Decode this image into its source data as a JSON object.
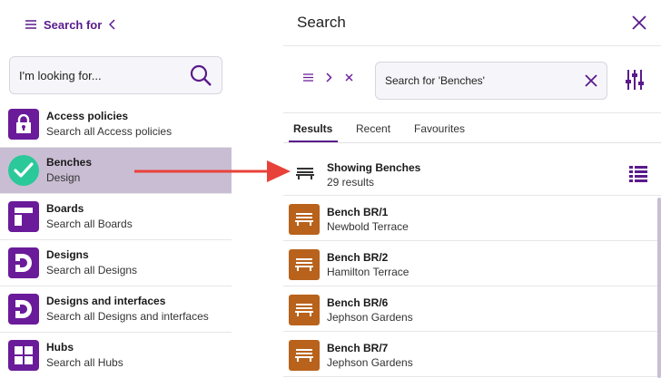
{
  "left_panel": {
    "header_title": "Search for",
    "search_placeholder": "I'm looking for...",
    "items": [
      {
        "title": "Access policies",
        "subtitle": "Search all Access policies",
        "icon": "lock-icon"
      },
      {
        "title": "Benches",
        "subtitle": "Design",
        "icon": "check-icon",
        "selected": true
      },
      {
        "title": "Boards",
        "subtitle": "Search all Boards",
        "icon": "board-icon"
      },
      {
        "title": "Designs",
        "subtitle": "Search all Designs",
        "icon": "design-icon"
      },
      {
        "title": "Designs and interfaces",
        "subtitle": "Search all Designs and interfaces",
        "icon": "design-icon"
      },
      {
        "title": "Hubs",
        "subtitle": "Search all Hubs",
        "icon": "grid-icon"
      }
    ]
  },
  "right_panel": {
    "title": "Search",
    "search_value": "Search for 'Benches'",
    "tabs": [
      {
        "label": "Results",
        "active": true
      },
      {
        "label": "Recent",
        "active": false
      },
      {
        "label": "Favourites",
        "active": false
      }
    ],
    "showing_title": "Showing Benches",
    "showing_count": "29 results",
    "results": [
      {
        "title": "Bench BR/1",
        "subtitle": "Newbold Terrace"
      },
      {
        "title": "Bench BR/2",
        "subtitle": "Hamilton Terrace"
      },
      {
        "title": "Bench BR/6",
        "subtitle": "Jephson Gardens"
      },
      {
        "title": "Bench BR/7",
        "subtitle": "Jephson Gardens"
      }
    ]
  },
  "colors": {
    "accent": "#5a1a8c",
    "icon_bg": "#6a1b9a",
    "selected_row": "#c9bdd3",
    "check": "#2bc99a",
    "thumb": "#b8621b",
    "arrow": "#e8413a"
  }
}
